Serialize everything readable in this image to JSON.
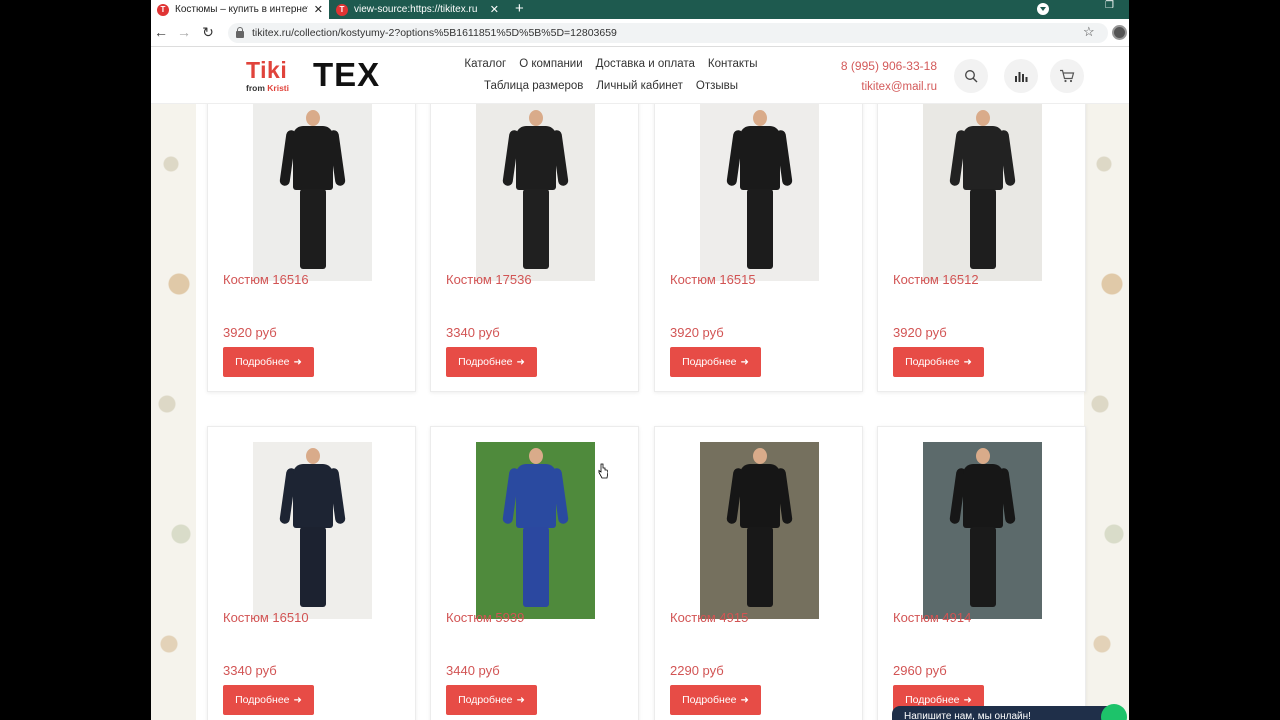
{
  "browser": {
    "tabs": [
      {
        "title": "Костюмы – купить в интернет м"
      },
      {
        "title": "view-source:https://tikitex.ru"
      }
    ],
    "url": "tikitex.ru/collection/kostyumy-2?options%5B1611851%5D%5B%5D=12803659"
  },
  "site": {
    "logo": {
      "main": "Tiki",
      "from": "from",
      "brand": "Kristi",
      "tex": "TEX"
    },
    "nav": [
      "Каталог",
      "О компании",
      "Доставка и оплата",
      "Контакты",
      "Таблица размеров",
      "Личный кабинет",
      "Отзывы"
    ],
    "phone": "8 (995) 906-33-18",
    "email": "tikitex@mail.ru",
    "chat_label": "Напишите нам, мы онлайн!"
  },
  "products": [
    {
      "name": "Костюм 16516",
      "price": "3920 руб",
      "button": "Подробнее",
      "photo": {
        "bg": "#ededeb",
        "suit": "#1b1b1b",
        "pants": "#1d1d1d"
      }
    },
    {
      "name": "Костюм 17536",
      "price": "3340 руб",
      "button": "Подробнее",
      "photo": {
        "bg": "#ecebe8",
        "suit": "#1e1e1e",
        "pants": "#202020"
      }
    },
    {
      "name": "Костюм 16515",
      "price": "3920 руб",
      "button": "Подробнее",
      "photo": {
        "bg": "#eeedeb",
        "suit": "#1a1a1a",
        "pants": "#1c1c1c"
      }
    },
    {
      "name": "Костюм 16512",
      "price": "3920 руб",
      "button": "Подробнее",
      "photo": {
        "bg": "#e9e8e4",
        "suit": "#222222",
        "pants": "#1e1e1e"
      }
    },
    {
      "name": "Костюм 16510",
      "price": "3340 руб",
      "button": "Подробнее",
      "photo": {
        "bg": "#efeeeb",
        "suit": "#1d2433",
        "pants": "#1c2230"
      }
    },
    {
      "name": "Костюм 5939",
      "price": "3440 руб",
      "button": "Подробнее",
      "photo": {
        "bg": "#4f8a3c",
        "suit": "#2a4aa0",
        "pants": "#2b48a0"
      }
    },
    {
      "name": "Костюм 4915",
      "price": "2290 руб",
      "button": "Подробнее",
      "photo": {
        "bg": "#75705e",
        "suit": "#161616",
        "pants": "#181818"
      }
    },
    {
      "name": "Костюм 4914",
      "price": "2960 руб",
      "button": "Подробнее",
      "photo": {
        "bg": "#5c6a6b",
        "suit": "#171717",
        "pants": "#1a1a1a"
      }
    }
  ]
}
